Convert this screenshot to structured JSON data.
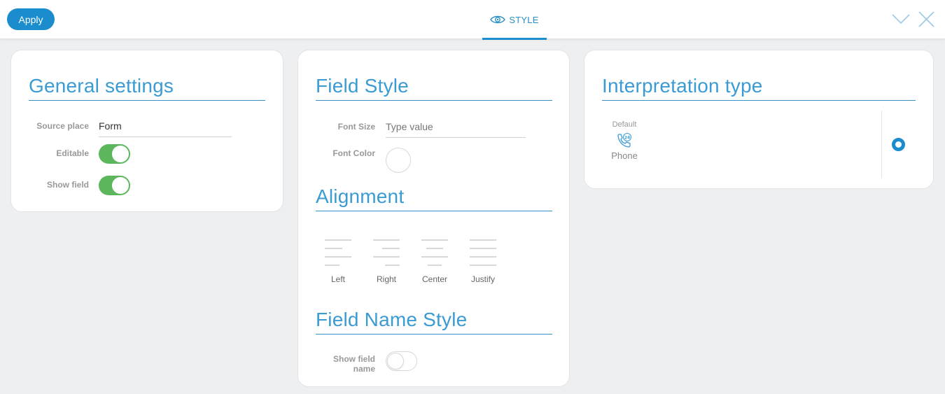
{
  "toolbar": {
    "apply_label": "Apply",
    "tab_label": "STYLE",
    "tab_icon": "eye-icon",
    "collapse_icon": "chevron-down-icon",
    "close_icon": "close-icon",
    "accent_color": "#1b8ccd"
  },
  "general": {
    "title": "General settings",
    "source_place_label": "Source place",
    "source_place_value": "Form",
    "editable_label": "Editable",
    "editable_on": true,
    "show_field_label": "Show field",
    "show_field_on": true,
    "toggle_on_color": "#5cb65c"
  },
  "field_style": {
    "title": "Field Style",
    "font_size_label": "Font Size",
    "font_size_placeholder": "Type value",
    "font_color_label": "Font Color",
    "alignment_title": "Alignment",
    "alignment_options": [
      {
        "label": "Left",
        "icon": "align-left-icon"
      },
      {
        "label": "Right",
        "icon": "align-right-icon"
      },
      {
        "label": "Center",
        "icon": "align-center-icon"
      },
      {
        "label": "Justify",
        "icon": "align-justify-icon"
      }
    ],
    "field_name_style_title": "Field Name Style",
    "show_field_name_label_line1": "Show field",
    "show_field_name_label_line2": "name",
    "show_field_name_on": false
  },
  "interpretation": {
    "title": "Interpretation type",
    "default_label": "Default",
    "option_label": "Phone",
    "option_icon": "phone-24-icon",
    "selected": true
  }
}
